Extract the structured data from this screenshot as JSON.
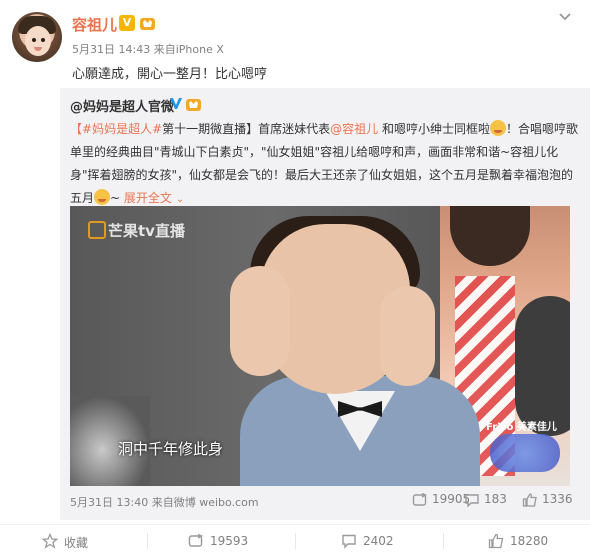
{
  "post": {
    "author": "容祖儿",
    "vip_badge": "V",
    "time": "5月31日 14:43",
    "source": "来自iPhone X",
    "text": "心願達成，開心一整月！比心嗯哼"
  },
  "repost": {
    "author": "@妈妈是超人官微",
    "body": {
      "p1": "【",
      "tag": "#妈妈是超人#",
      "p2": "第十一期微直播】首席迷妹代表",
      "mention": "@容祖儿",
      "p3": " 和嗯哼小绅士同框啦",
      "p4": "！合唱嗯哼歌单里的经典曲目\"青城山下白素贞\"，\"仙女姐姐\"容祖儿给嗯哼和声，画面非常和谐~容祖儿化身\"挥着翅膀的女孩\"，仙女都是会飞的！最后大王还亲了仙女姐姐，这个五月是飘着幸福泡泡的五月",
      "p5": "~ ",
      "expand": "展开全文",
      "expand_arrow": "⌄"
    },
    "video": {
      "logo": "芒果tv",
      "logo_suffix": "直播",
      "subtitle": "洞中千年修此身",
      "brand": "Friso 美素佳儿"
    },
    "time": "5月31日 13:40",
    "source": "来自微博 weibo.com",
    "stats": {
      "reposts": "19905",
      "comments": "183",
      "likes": "1336"
    }
  },
  "actions": {
    "favorite": "收藏",
    "repost": "19593",
    "comment": "2402",
    "like": "18280"
  },
  "colors": {
    "accent": "#eb7350",
    "muted": "#808080",
    "repost_bg": "#f2f2f5",
    "vip": "#f7b500",
    "verified_blue": "#1f96e8"
  },
  "icons": [
    "more-chevron-icon",
    "vip-badge-icon",
    "crown-level-icon",
    "verified-v-icon",
    "emoji-icon",
    "repost-icon",
    "comment-icon",
    "like-icon",
    "favorite-icon"
  ]
}
